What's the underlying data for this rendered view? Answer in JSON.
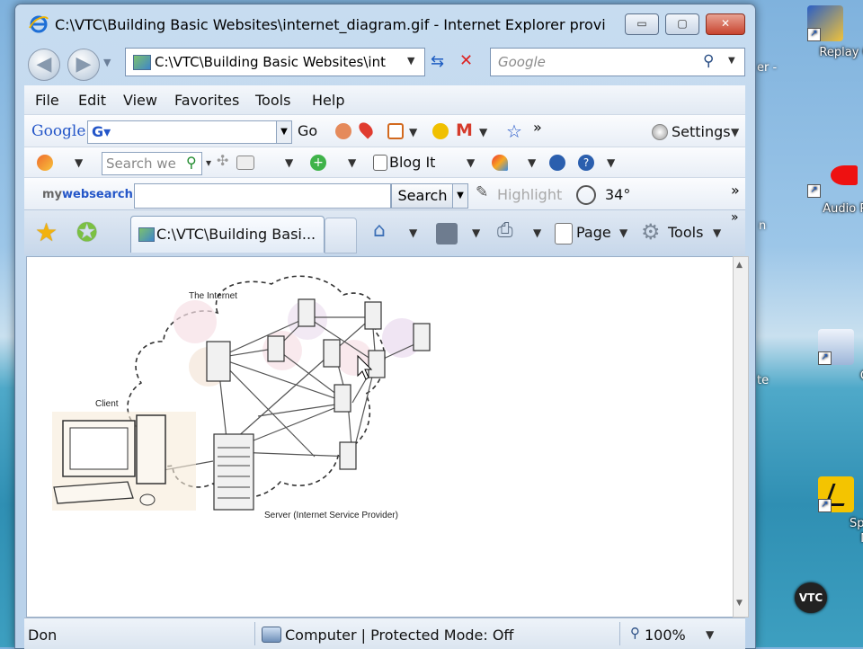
{
  "window": {
    "title": "C:\\VTC\\Building Basic Websites\\internet_diagram.gif - Internet Explorer provi",
    "min_label": "▭",
    "max_label": "▢",
    "close_label": "✕"
  },
  "navigation": {
    "back_icon": "back-arrow-icon",
    "forward_icon": "forward-arrow-icon",
    "address": "C:\\VTC\\Building Basic Websites\\int",
    "search_placeholder": "Google"
  },
  "menu": [
    "File",
    "Edit",
    "View",
    "Favorites",
    "Tools",
    "Help"
  ],
  "google_toolbar": {
    "logo": "Google",
    "go_label": "Go",
    "settings_label": "Settings"
  },
  "toolbar2": {
    "search_placeholder": "Search we",
    "blog_label": "Blog It"
  },
  "mywebsearch": {
    "logo_prefix": "my",
    "logo_brand": "websearch",
    "search_button": "Search",
    "highlight_label": "Highlight",
    "weather": "34°"
  },
  "tab": {
    "label": "C:\\VTC\\Building Basi...",
    "page_label": "Page",
    "tools_label": "Tools"
  },
  "diagram": {
    "internet_label": "The Internet",
    "client_label": "Client",
    "server_label": "Server (Internet Service Provider)"
  },
  "status": {
    "left": "Don",
    "zone": "Computer | Protected Mode: Off",
    "zoom": "100%"
  },
  "desktop": {
    "icons": [
      "Replay Co",
      "Audio Re",
      "Compu Short",
      "Sprint Co Mana"
    ],
    "edge_fragments": [
      "er -",
      "n",
      "te"
    ],
    "vtc_logo": "VTC"
  },
  "colors": {
    "window_frame": "#c7dcf0",
    "close_button": "#c8442f",
    "accent_blue": "#1d5cc2"
  }
}
